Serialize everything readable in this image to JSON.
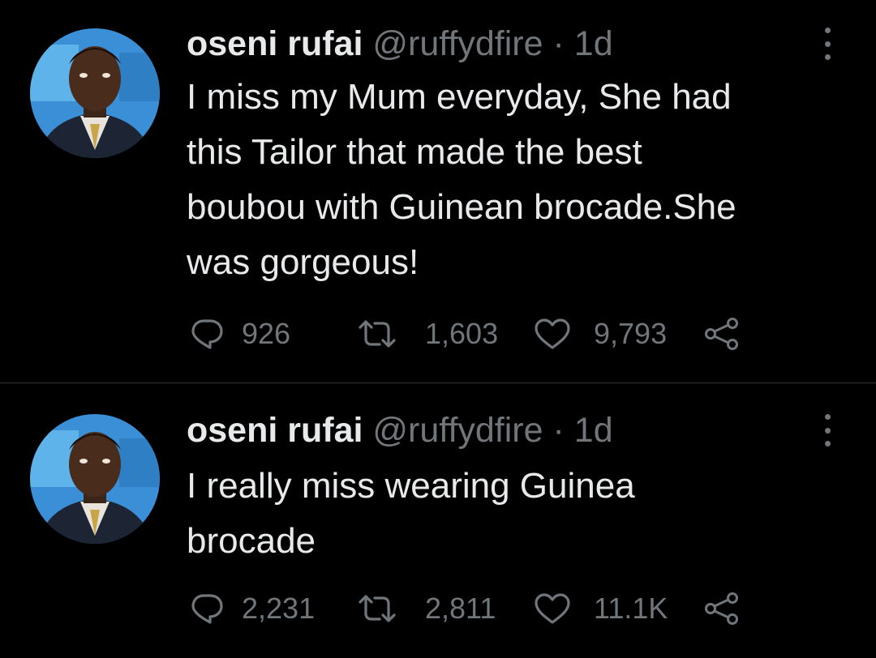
{
  "tweets": [
    {
      "name": "oseni rufai",
      "handle": "@ruffydfire",
      "separator": "·",
      "time": "1d",
      "text": "I miss my Mum everyday, She had this Tailor that made the best boubou with Guinean brocade.She was gorgeous!",
      "lines": [
        "I miss my Mum everyday, She had",
        "this Tailor that made the best",
        "boubou with Guinean brocade.She",
        "was gorgeous!"
      ],
      "replies": "926",
      "retweets": "1,603",
      "likes": "9,793"
    },
    {
      "name": "oseni rufai",
      "handle": "@ruffydfire",
      "separator": "·",
      "time": "1d",
      "text": "I really miss wearing Guinea brocade",
      "lines": [
        "I really miss wearing Guinea",
        "brocade"
      ],
      "replies": "2,231",
      "retweets": "2,811",
      "likes": "11.1K"
    }
  ],
  "icons": {
    "reply": "reply-icon",
    "retweet": "retweet-icon",
    "like": "heart-icon",
    "share": "share-icon",
    "more": "more-options-icon"
  },
  "colors": {
    "background": "#000000",
    "text": "#e7e9ea",
    "secondary": "#71767b",
    "divider": "#2f3336"
  }
}
